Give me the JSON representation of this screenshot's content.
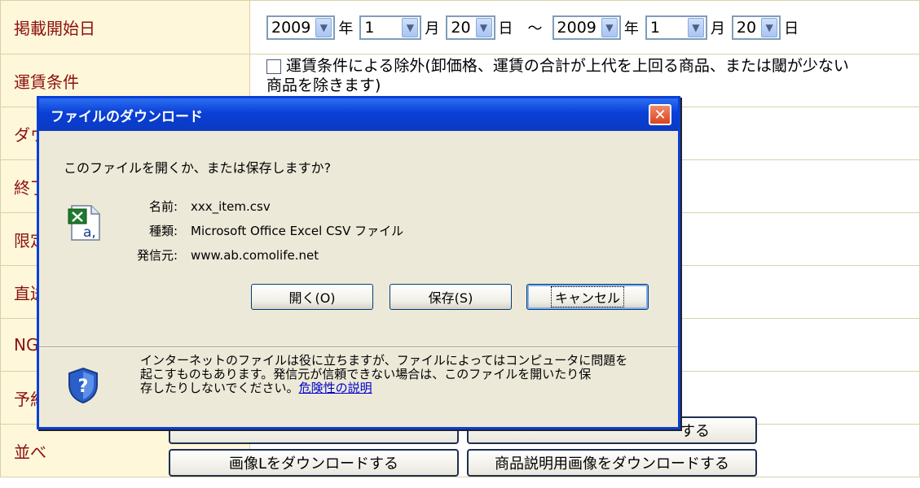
{
  "form": {
    "rows": [
      {
        "label": "掲載開始日"
      },
      {
        "label": "運賃条件"
      },
      {
        "label": "ダウ"
      },
      {
        "label": "終了"
      },
      {
        "label": "限定"
      },
      {
        "label": "直送"
      },
      {
        "label": "NG"
      },
      {
        "label": "予約"
      },
      {
        "label": "並べ"
      }
    ],
    "date_from": {
      "year": "2009",
      "month": "1",
      "day": "20"
    },
    "date_to": {
      "year": "2009",
      "month": "1",
      "day": "20"
    },
    "units": {
      "year": "年",
      "month": "月",
      "day": "日",
      "range": "～"
    },
    "condition_checkbox_label": "運賃条件による除外(卸価格、運賃の合計が上代を上回る商品、または閾が少ない",
    "condition_checkbox_label_line2": "商品を除きます)"
  },
  "bottom_buttons": {
    "partial_right": "する",
    "download_image_l": "画像Lをダウンロードする",
    "download_desc_images": "商品説明用画像をダウンロードする"
  },
  "dialog": {
    "title": "ファイルのダウンロード",
    "question": "このファイルを開くか、または保存しますか?",
    "name_label": "名前:",
    "name_value": "xxx_item.csv",
    "type_label": "種類:",
    "type_value": "Microsoft Office Excel CSV ファイル",
    "source_label": "発信元:",
    "source_value": "www.ab.comolife.net",
    "open_button": "開く(O)",
    "save_button": "保存(S)",
    "cancel_button": "キャンセル",
    "warning_line1": "インターネットのファイルは役に立ちますが、ファイルによってはコンピュータに問題を",
    "warning_line2": "起こすものもあります。発信元が信頼できない場合は、このファイルを開いたり保",
    "warning_line3": "存したりしないでください。",
    "risk_link": "危険性の説明",
    "close_glyph": "✕"
  },
  "colors": {
    "title_bar": "#0a3fd6",
    "label_text": "#8b1010",
    "label_bg": "#fff7d9",
    "link": "#0000cc"
  }
}
